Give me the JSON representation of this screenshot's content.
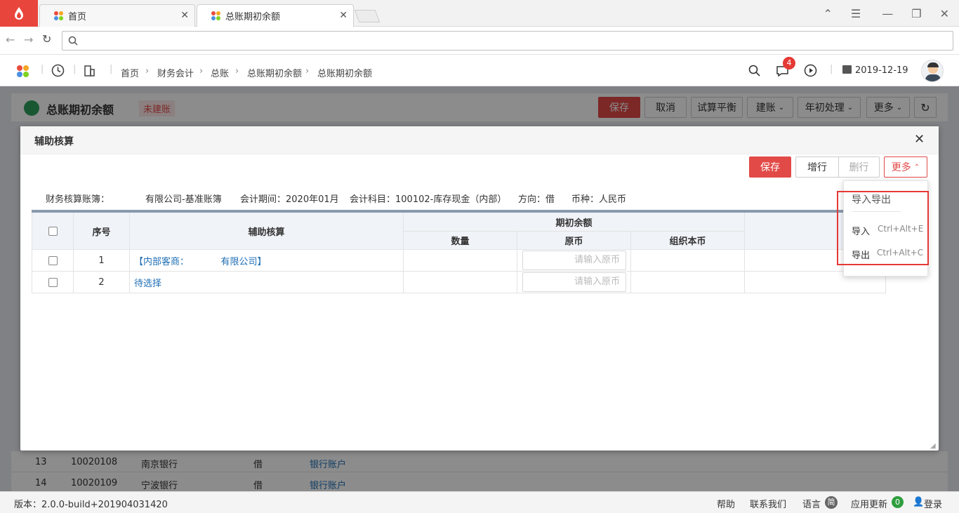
{
  "browser": {
    "tabs": [
      {
        "label": "首页"
      },
      {
        "label": "总账期初余额"
      }
    ],
    "address": ""
  },
  "nav": {
    "breadcrumbs": [
      "首页",
      "财务会计",
      "总账",
      "总账期初余额",
      "总账期初余额"
    ],
    "notification_count": "4",
    "date": "2019-12-19"
  },
  "page": {
    "title": "总账期初余额",
    "status_tag": "未建账",
    "buttons": {
      "save": "保存",
      "cancel": "取消",
      "trial_balance": "试算平衡",
      "create_book": "建账",
      "year_start": "年初处理",
      "more": "更多"
    },
    "bg_rows": [
      {
        "index": "13",
        "code": "10020108",
        "name": "南京银行",
        "direction": "借",
        "aux": "银行账户"
      },
      {
        "index": "14",
        "code": "10020109",
        "name": "宁波银行",
        "direction": "借",
        "aux": "银行账户"
      }
    ]
  },
  "dialog": {
    "title": "辅助核算",
    "buttons": {
      "save": "保存",
      "add_row": "增行",
      "delete_row": "删行",
      "more": "更多"
    },
    "info": {
      "book_label": "财务核算账簿：",
      "book_value": "有限公司-基准账簿",
      "period": "会计期间：2020年01月",
      "account": "会计科目：100102-库存现金（内部）",
      "direction": "方向：借",
      "currency": "币种：人民币"
    },
    "columns": {
      "index": "序号",
      "aux": "辅助核算",
      "opening": "期初余额",
      "qty": "数量",
      "orig": "原币",
      "org": "组织本币"
    },
    "rows": [
      {
        "index": "1",
        "aux": "【内部客商：　　　　有限公司】",
        "placeholder": "请输入原币"
      },
      {
        "index": "2",
        "aux": "待选择",
        "placeholder": "请输入原币"
      }
    ]
  },
  "menu": {
    "header": "导入导出",
    "items": [
      {
        "label": "导入",
        "shortcut": "Ctrl+Alt+E"
      },
      {
        "label": "导出",
        "shortcut": "Ctrl+Alt+C"
      }
    ]
  },
  "status": {
    "version": "版本：2.0.0-build+201904031420",
    "help": "帮助",
    "contact": "联系我们",
    "language": "语言",
    "lang_badge": "简",
    "update": "应用更新",
    "update_count": "0",
    "login": "登录"
  },
  "colors": {
    "accent": "#e14a47",
    "link": "#1f6fb5",
    "highlight": "#e53935"
  }
}
